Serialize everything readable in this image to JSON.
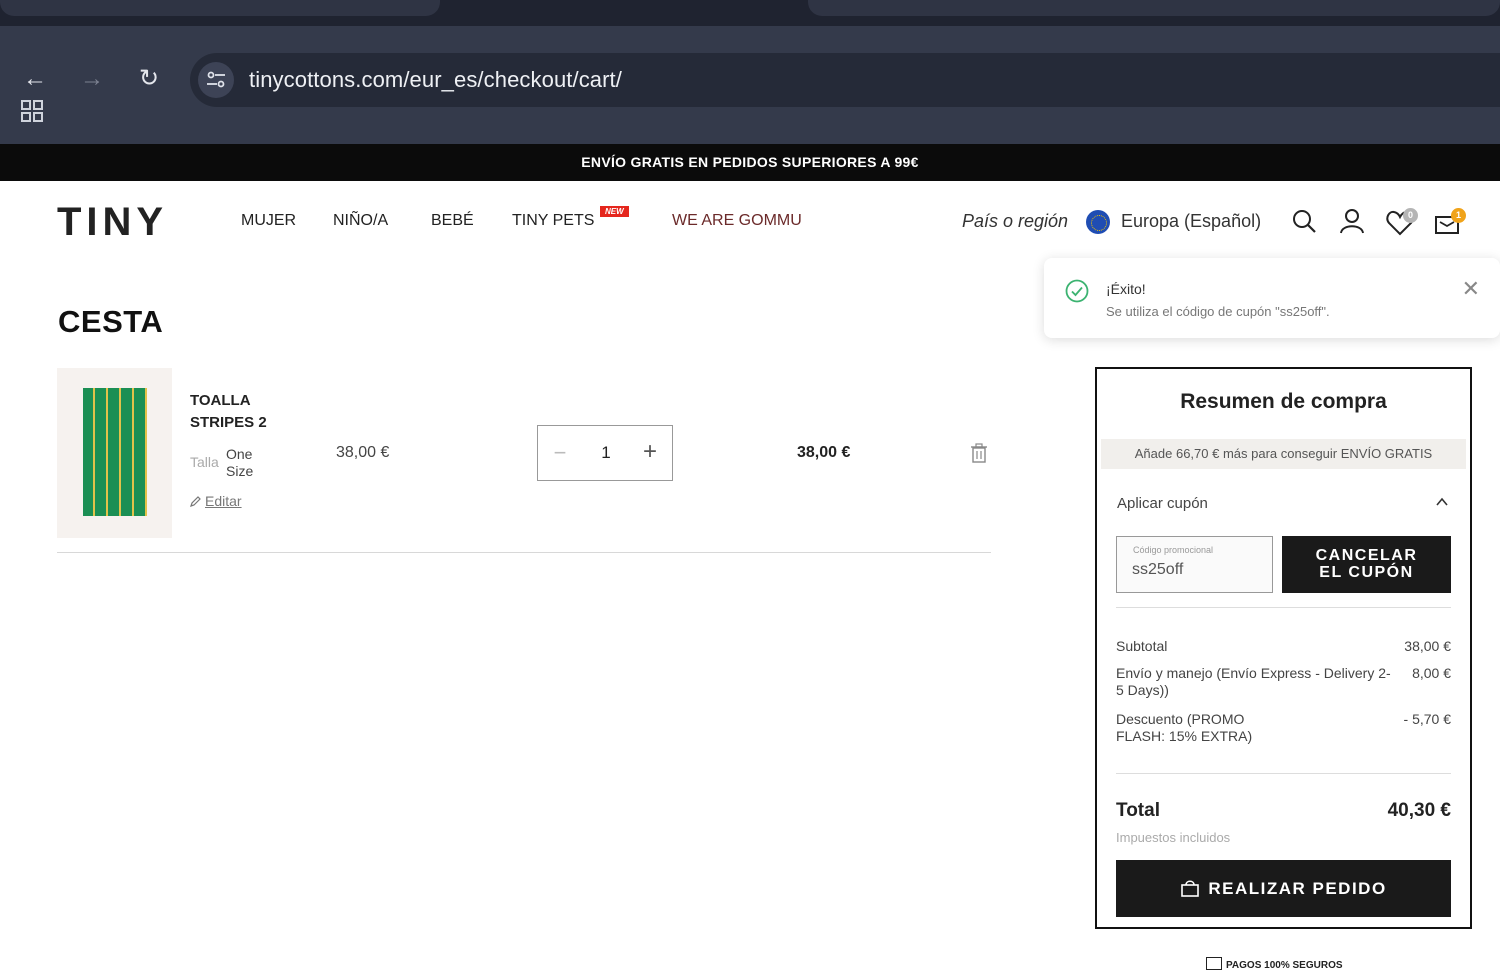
{
  "browser": {
    "url": "tinycottons.com/eur_es/checkout/cart/"
  },
  "promo_bar": {
    "text": "ENVÍO GRATIS EN PEDIDOS SUPERIORES A 99€"
  },
  "header": {
    "logo": "TINY",
    "nav": [
      {
        "label": "MUJER"
      },
      {
        "label": "NIÑO/A"
      },
      {
        "label": "BEBÉ"
      },
      {
        "label": "TINY PETS",
        "badge": "NEW"
      },
      {
        "label": "WE ARE GOMMU"
      }
    ],
    "region_label": "País o región",
    "region_value": "Europa (Español)",
    "wishlist_count": "0",
    "cart_count": "1"
  },
  "toast": {
    "title": "¡Éxito!",
    "message": "Se utiliza el código de cupón \"ss25off\"."
  },
  "cart": {
    "title": "CESTA",
    "items": [
      {
        "name": "TOALLA STRIPES 2",
        "size_label": "Talla",
        "size_value": "One Size",
        "edit_label": "Editar",
        "unit_price": "38,00 €",
        "quantity": "1",
        "line_total": "38,00 €"
      }
    ]
  },
  "summary": {
    "title": "Resumen de compra",
    "free_shipping_note": "Añade 66,70 € más para conseguir ENVÍO GRATIS",
    "coupon_header": "Aplicar cupón",
    "coupon_field_label": "Código promocional",
    "coupon_code": "ss25off",
    "cancel_coupon_label": "CANCELAR EL CUPÓN",
    "rows": [
      {
        "label": "Subtotal",
        "value": "38,00 €"
      },
      {
        "label": "Envío y manejo (Envío Express - Delivery 2-5 Days))",
        "value": "8,00 €"
      },
      {
        "label": "Descuento (PROMO FLASH: 15% EXTRA)",
        "value": "- 5,70 €"
      }
    ],
    "total_label": "Total",
    "total_value": "40,30 €",
    "tax_note": "Impuestos incluidos",
    "order_button": "REALIZAR PEDIDO"
  },
  "footer": {
    "secure_payments": "PAGOS 100% SEGUROS"
  },
  "colors": {
    "accent_nav": "#6b2a2a",
    "new_badge": "#e5261d",
    "success": "#3cb371",
    "cart_badge": "#f0a31a"
  }
}
